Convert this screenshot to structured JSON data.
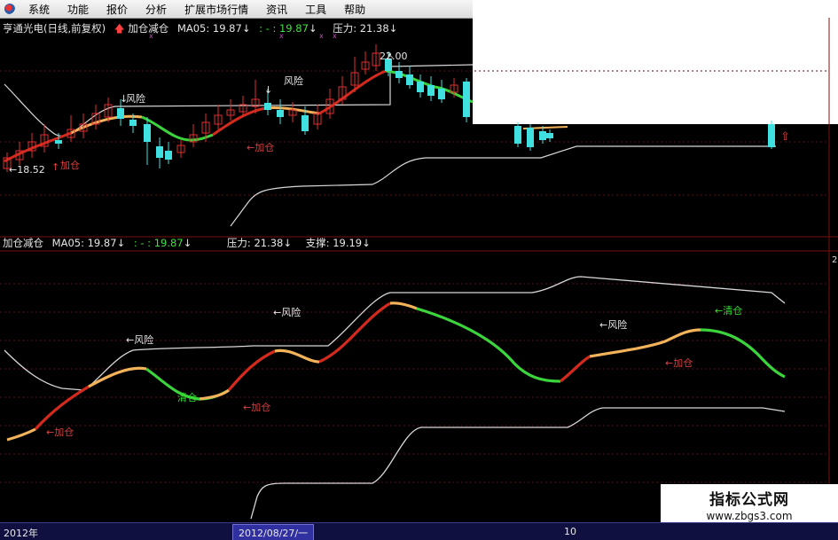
{
  "menu": {
    "items": [
      "系统",
      "功能",
      "报价",
      "分析",
      "扩展市场行情",
      "资讯",
      "工具",
      "帮助"
    ]
  },
  "top_panel": {
    "stock_title": "亨通光电(日线,前复权)",
    "indicator_name": "加仓减仓",
    "ma_label": "MA05: 19.87",
    "ma_arrow": "↓",
    "dots_label": ": - : 19.87",
    "dots_arrow": "↓",
    "pressure_label": "压力: 21.38",
    "pressure_arrow": "↓",
    "high_price": "22.00",
    "low_price": "18.52",
    "annotations": {
      "risk_1": "风险",
      "risk_2": "风险",
      "add_1": "加仓",
      "add_2": "加仓"
    }
  },
  "bottom_panel": {
    "indicator_name": "加仓减仓",
    "ma_label": "MA05: 19.87",
    "ma_arrow": "↓",
    "dots_label": ": - : 19.87",
    "dots_arrow": "↓",
    "pressure_label": "压力: 21.38",
    "pressure_arrow": "↓",
    "support_label": "支撑: 19.19",
    "support_arrow": "↓",
    "annotations": {
      "add_1": "←加仓",
      "risk_1": "←风险",
      "clear_1": "清仓",
      "add_2": "←加仓",
      "risk_2": "←风险",
      "risk_3": "←风险",
      "add_3": "←加仓",
      "clear_2": "←清仓"
    },
    "edge_label": "2"
  },
  "status_bar": {
    "year": "2012年",
    "date": "2012/08/27/一",
    "ten": "10"
  },
  "watermark": {
    "title": "指标公式网",
    "url": "www.zbgs3.com"
  },
  "colors": {
    "up_candle": "#e03030",
    "down_candle": "#40e0e0",
    "line_red": "#d42a1e",
    "line_orange": "#f3b35a",
    "line_green": "#3cd43c",
    "band": "#d8d8d8"
  }
}
